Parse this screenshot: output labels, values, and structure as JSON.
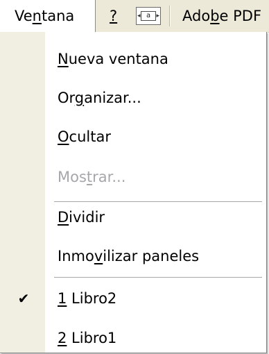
{
  "menubar": {
    "active_menu": "Ventana",
    "active_pre": "Ve",
    "active_mnemonic": "n",
    "active_post": "tana",
    "help_label": "?",
    "icon_label": "a",
    "pdf_pre": "Ado",
    "pdf_mnemonic": "b",
    "pdf_post": "e PDF"
  },
  "dropdown": {
    "items": [
      {
        "pre": "",
        "mnemonic": "N",
        "post": "ueva ventana",
        "enabled": true,
        "checked": false
      },
      {
        "pre": "Or",
        "mnemonic": "g",
        "post": "anizar...",
        "enabled": true,
        "checked": false
      },
      {
        "pre": "",
        "mnemonic": "O",
        "post": "cultar",
        "enabled": true,
        "checked": false
      },
      {
        "pre": "Mos",
        "mnemonic": "t",
        "post": "rar...",
        "enabled": false,
        "checked": false
      },
      {
        "pre": "",
        "mnemonic": "D",
        "post": "ividir",
        "enabled": true,
        "checked": false
      },
      {
        "pre": "Inmo",
        "mnemonic": "v",
        "post": "ilizar paneles",
        "enabled": true,
        "checked": false
      },
      {
        "pre": "",
        "mnemonic": "1",
        "post": " Libro2",
        "enabled": true,
        "checked": true
      },
      {
        "pre": "",
        "mnemonic": "2",
        "post": " Libro1",
        "enabled": true,
        "checked": false
      }
    ],
    "check_glyph": "✔"
  },
  "colors": {
    "menubar_bg": "#ece9d8",
    "gutter_bg": "#f1efe2",
    "disabled_text": "#a7a6aa",
    "separator": "#a6a6a6"
  }
}
